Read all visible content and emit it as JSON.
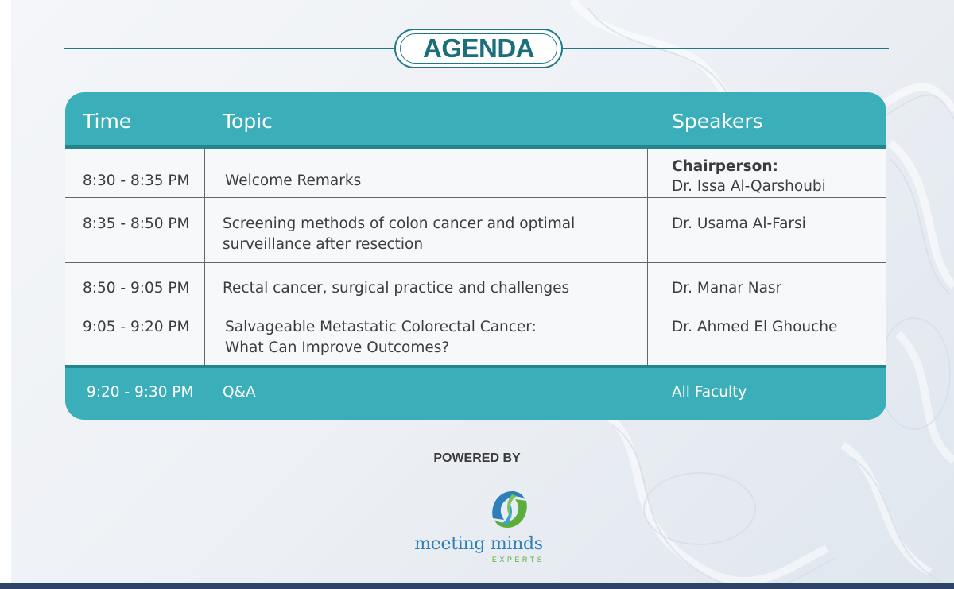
{
  "header": {
    "title": "AGENDA"
  },
  "table": {
    "headers": {
      "time": "Time",
      "topic": "Topic",
      "speakers": "Speakers"
    },
    "rows": [
      {
        "time": "8:30 - 8:35 PM",
        "topic": "Welcome Remarks",
        "speaker_role": "Chairperson:",
        "speaker": "Dr. Issa Al-Qarshoubi"
      },
      {
        "time": "8:35 - 8:50 PM",
        "topic_line1": "Screening methods of colon cancer and optimal",
        "topic_line2": "surveillance after resection",
        "speaker": "Dr. Usama Al-Farsi"
      },
      {
        "time": "8:50 - 9:05 PM",
        "topic": "Rectal cancer, surgical practice and challenges",
        "speaker": "Dr. Manar Nasr"
      },
      {
        "time": "9:05 - 9:20 PM",
        "topic_line1": "Salvageable Metastatic Colorectal Cancer:",
        "topic_line2": "What Can Improve Outcomes?",
        "speaker": "Dr. Ahmed El Ghouche"
      }
    ],
    "footer": {
      "time": "9:20 - 9:30 PM",
      "topic": "Q&A",
      "speaker": "All Faculty"
    }
  },
  "sponsor": {
    "label": "POWERED BY",
    "name": "meeting minds",
    "subtitle": "EXPERTS"
  },
  "colors": {
    "teal": "#3aafb9",
    "dark_teal": "#1e7b85",
    "logo_blue": "#2c7fb8",
    "logo_green": "#5cae3c",
    "bottom_bar": "#2d4466"
  }
}
